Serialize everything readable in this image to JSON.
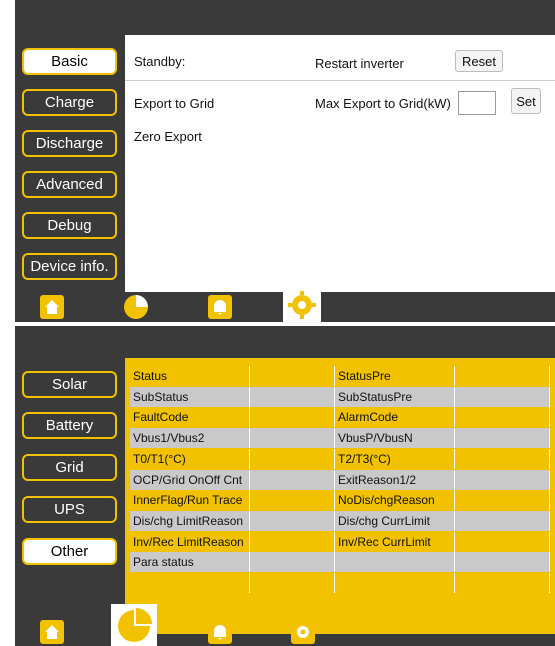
{
  "screen1": {
    "sidebar": [
      "Basic",
      "Charge",
      "Discharge",
      "Advanced",
      "Debug",
      "Device info."
    ],
    "active_index": 0,
    "standby_label": "Standby:",
    "restart_label": "Restart inverter",
    "reset_label": "Reset",
    "export_grid_label": "Export to Grid",
    "max_export_label": "Max Export to Grid(kW)",
    "max_export_value": "",
    "set_label": "Set",
    "zero_export_label": "Zero Export"
  },
  "screen2": {
    "sidebar": [
      "Solar",
      "Battery",
      "Grid",
      "UPS",
      "Other"
    ],
    "active_index": 4,
    "rows": [
      [
        "Status",
        "",
        "StatusPre",
        ""
      ],
      [
        "SubStatus",
        "",
        "SubStatusPre",
        ""
      ],
      [
        "FaultCode",
        "",
        "AlarmCode",
        ""
      ],
      [
        "Vbus1/Vbus2",
        "",
        "VbusP/VbusN",
        ""
      ],
      [
        "T0/T1(°C)",
        "",
        "T2/T3(°C)",
        ""
      ],
      [
        "OCP/Grid OnOff Cnt",
        "",
        "ExitReason1/2",
        ""
      ],
      [
        "InnerFlag/Run Trace",
        "",
        "NoDis/chgReason",
        ""
      ],
      [
        "Dis/chg LimitReason",
        "",
        "Dis/chg CurrLimit",
        ""
      ],
      [
        "Inv/Rec LimitReason",
        "",
        "Inv/Rec CurrLimit",
        ""
      ],
      [
        "Para status",
        "",
        "",
        ""
      ],
      [
        "",
        "",
        "",
        ""
      ]
    ]
  },
  "nav": [
    "home-icon",
    "pie-chart-icon",
    "bell-icon",
    "gear-icon"
  ],
  "colors": {
    "accent": "#f2c200",
    "panel": "#3a3a3a",
    "row_gray": "#c9c9c9"
  }
}
